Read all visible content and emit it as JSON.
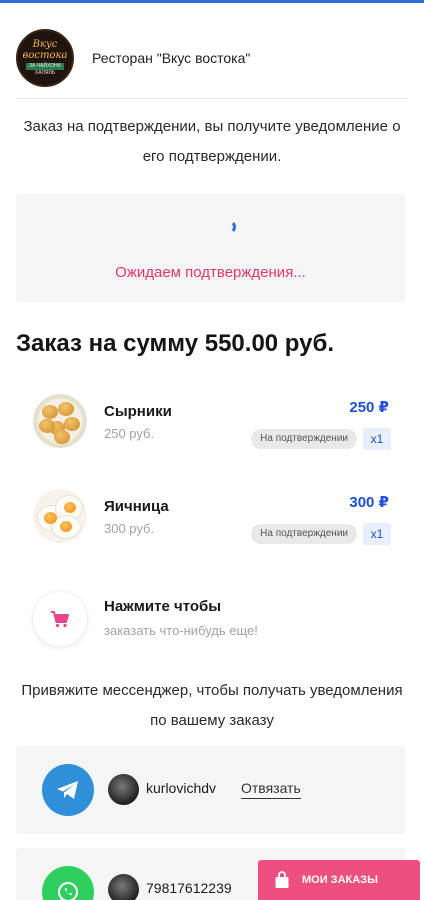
{
  "header": {
    "logo_lines": [
      "Вкус",
      "востока",
      "ЗА ЧАЙХОНА",
      "ХАЛЯЛЬ"
    ],
    "restaurant_name": "Ресторан \"Вкус востока\""
  },
  "status": {
    "notice": "Заказ на подтверждении, вы получите уведомление о его подтверждении.",
    "waiting_text": "Ожидаем подтверждения..."
  },
  "order": {
    "title": "Заказ на сумму 550.00 руб.",
    "items": [
      {
        "name": "Сырники",
        "subprice": "250 руб.",
        "price": "250 ₽",
        "status": "На подтверждении",
        "qty": "x1"
      },
      {
        "name": "Яичница",
        "subprice": "300 руб.",
        "price": "300 ₽",
        "status": "На подтверждении",
        "qty": "x1"
      }
    ],
    "add_more": {
      "title": "Нажмите чтобы",
      "subtitle": "заказать что-нибудь еще!"
    }
  },
  "messenger": {
    "prompt": "Привяжите мессенджер, чтобы получать уведомления по вашему заказу",
    "accounts": [
      {
        "service": "telegram",
        "username": "kurlovichdv",
        "action": "Отвязать"
      },
      {
        "service": "whatsapp",
        "username": "79817612239"
      }
    ]
  },
  "bottom_button": {
    "label": "МОИ ЗАКАЗЫ"
  },
  "colors": {
    "accent_blue": "#1e4fd8",
    "accent_pink": "#ee4f7f",
    "waiting_pink": "#e6356b",
    "telegram": "#2f8fd8",
    "whatsapp": "#2fcf5f"
  },
  "icons": [
    "loading-spinner-icon",
    "cart-icon",
    "telegram-icon",
    "whatsapp-icon",
    "shopping-bag-icon"
  ]
}
